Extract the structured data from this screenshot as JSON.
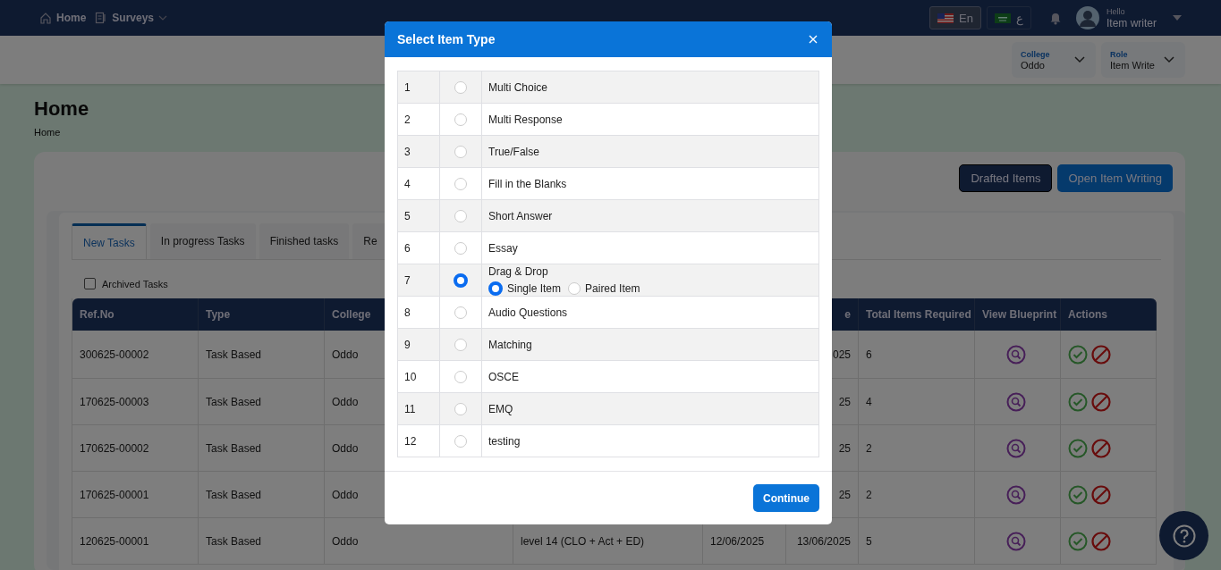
{
  "top_nav": {
    "items": [
      {
        "label": "Home",
        "kind": "home"
      },
      {
        "label": "Surveys",
        "kind": "dropdown"
      }
    ],
    "languages": [
      {
        "label": "En",
        "kind": "us",
        "selected": true
      },
      {
        "label": "ع",
        "kind": "sa",
        "selected": false
      }
    ],
    "user": {
      "greeting": "Hello",
      "name": "Item writer"
    }
  },
  "selectors": [
    {
      "label": "College",
      "value": "Oddo"
    },
    {
      "label": "Role",
      "value": "Item Write"
    }
  ],
  "page": {
    "title": "Home",
    "breadcrumb": "Home"
  },
  "buttons": [
    {
      "label": "Drafted Items",
      "kind": "dark"
    },
    {
      "label": "Open Item Writing",
      "kind": "primary"
    }
  ],
  "tabs": [
    {
      "label": "New Tasks",
      "selected": true
    },
    {
      "label": "In progress Tasks",
      "selected": false
    },
    {
      "label": "Finished tasks",
      "selected": false
    },
    {
      "label": "Re",
      "selected": false
    }
  ],
  "archived_filter": {
    "label": "Archived Tasks",
    "checked": false
  },
  "table": {
    "columns": [
      "Ref.No",
      "Type",
      "College",
      null,
      null,
      "e",
      "Total Items Required",
      "View Blueprint",
      "Actions"
    ],
    "rows": [
      {
        "cells": [
          "300625-00002",
          "Task Based",
          "Oddo",
          null,
          null,
          "025",
          "6"
        ]
      },
      {
        "cells": [
          "170625-00003",
          "Task Based",
          "Oddo",
          null,
          null,
          "25",
          "4"
        ]
      },
      {
        "cells": [
          "170625-00002",
          "Task Based",
          "Oddo",
          null,
          null,
          "25",
          "2"
        ]
      },
      {
        "cells": [
          "170625-00001",
          "Task Based",
          "Oddo",
          null,
          null,
          "25",
          "2"
        ]
      },
      {
        "cells": [
          "120625-00001",
          "Task Based",
          "Oddo",
          "level 14 (CLO + Act + ED)",
          "12/06/2025",
          "13/06/2025",
          "5"
        ]
      }
    ]
  },
  "modal": {
    "title": "Select Item Type",
    "button": "Continue",
    "items": [
      {
        "number": "1",
        "label": "Multi Choice",
        "selected": false
      },
      {
        "number": "2",
        "label": "Multi Response",
        "selected": false
      },
      {
        "number": "3",
        "label": "True/False",
        "selected": false
      },
      {
        "number": "4",
        "label": "Fill in the Blanks",
        "selected": false
      },
      {
        "number": "5",
        "label": "Short Answer",
        "selected": false
      },
      {
        "number": "6",
        "label": "Essay",
        "selected": false
      },
      {
        "number": "7",
        "label": "Drag & Drop",
        "selected": true,
        "options": [
          {
            "label": "Single Item",
            "selected": true
          },
          {
            "label": "Paired Item",
            "selected": false
          }
        ]
      },
      {
        "number": "8",
        "label": "Audio Questions",
        "selected": false
      },
      {
        "number": "9",
        "label": "Matching",
        "selected": false
      },
      {
        "number": "10",
        "label": "OSCE",
        "selected": false
      },
      {
        "number": "11",
        "label": "EMQ",
        "selected": false
      },
      {
        "number": "12",
        "label": "testing",
        "selected": false
      }
    ]
  }
}
